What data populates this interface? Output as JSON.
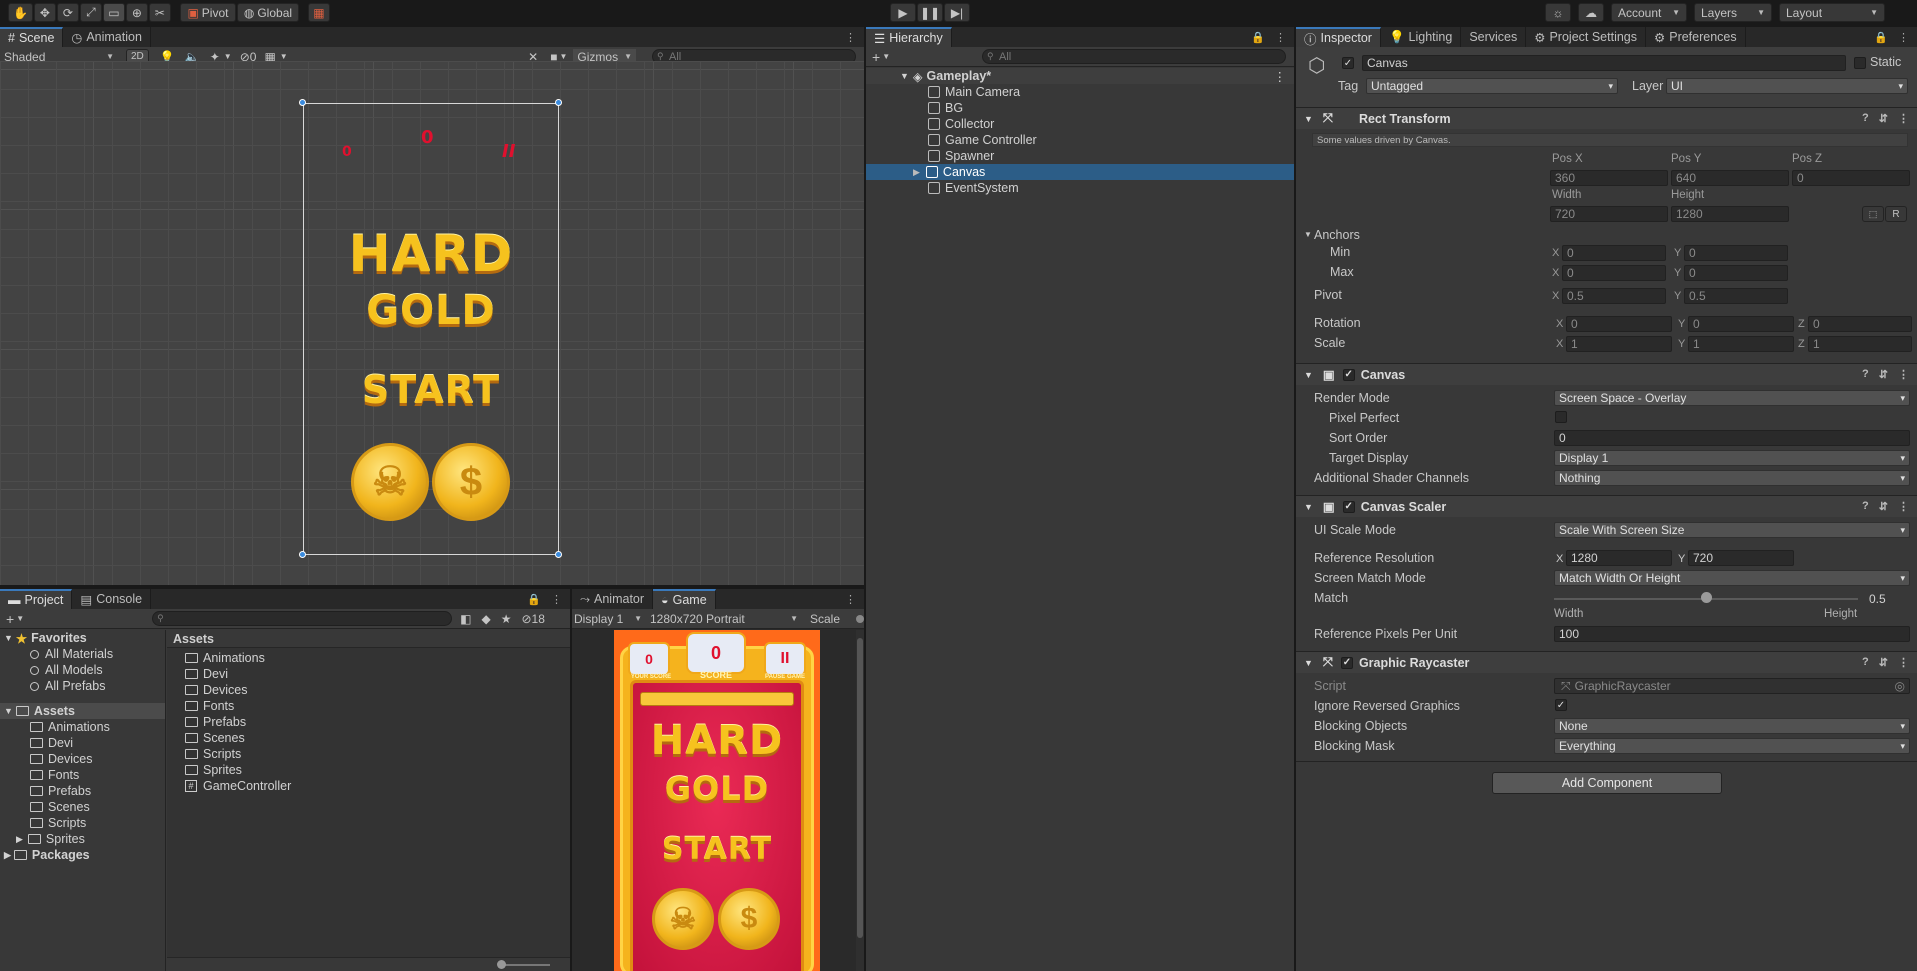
{
  "toolbar": {
    "pivot": "Pivot",
    "global": "Global",
    "account": "Account",
    "layers": "Layers",
    "layout": "Layout"
  },
  "scene": {
    "tabs": [
      "Scene",
      "Animation"
    ],
    "shade": "Shaded",
    "mode2d": "2D",
    "hidden_count": "0",
    "gizmos": "Gizmos",
    "search_placeholder": "All",
    "game": {
      "icon1": "0",
      "icon2": "0",
      "icon3": "II",
      "title1": "HARD",
      "title2": "GOLD",
      "start": "START"
    }
  },
  "hierarchy": {
    "tab": "Hierarchy",
    "search_placeholder": "All",
    "root": "Gameplay*",
    "items": [
      "Main Camera",
      "BG",
      "Collector",
      "Game Controller",
      "Spawner",
      "Canvas",
      "EventSystem"
    ]
  },
  "project": {
    "tabs": [
      "Project",
      "Console"
    ],
    "count": "18",
    "favorites": {
      "label": "Favorites",
      "items": [
        "All Materials",
        "All Models",
        "All Prefabs"
      ]
    },
    "assets": {
      "label": "Assets",
      "items": [
        "Animations",
        "Devi",
        "Devices",
        "Fonts",
        "Prefabs",
        "Scenes",
        "Scripts",
        "Sprites"
      ]
    },
    "packages": "Packages",
    "grid_header": "Assets",
    "grid_items": [
      "Animations",
      "Devi",
      "Devices",
      "Fonts",
      "Prefabs",
      "Scenes",
      "Scripts",
      "Sprites",
      "GameController"
    ]
  },
  "game": {
    "tabs": [
      "Animator",
      "Game"
    ],
    "display": "Display 1",
    "resolution": "1280x720 Portrait",
    "scale_label": "Scale",
    "view": {
      "badge1": "0",
      "badge2": "0",
      "badge3": "II",
      "left_label": "YOUR SCORE",
      "mid_label": "SCORE",
      "right_label": "PAUSE GAME",
      "title1": "HARD",
      "title2": "GOLD",
      "start": "START"
    }
  },
  "inspector": {
    "tabs": [
      "Inspector",
      "Lighting",
      "Services",
      "Project Settings",
      "Preferences"
    ],
    "object_name": "Canvas",
    "static": "Static",
    "tag_label": "Tag",
    "tag": "Untagged",
    "layer_label": "Layer",
    "layer": "UI",
    "rect": {
      "title": "Rect Transform",
      "note": "Some values driven by Canvas.",
      "posx_label": "Pos X",
      "posy_label": "Pos Y",
      "posz_label": "Pos Z",
      "posx": "360",
      "posy": "640",
      "posz": "0",
      "width_label": "Width",
      "height_label": "Height",
      "width": "720",
      "height": "1280",
      "anchors": "Anchors",
      "min": "Min",
      "max": "Max",
      "min_x": "0",
      "min_y": "0",
      "max_x": "0",
      "max_y": "0",
      "pivot": "Pivot",
      "pivot_x": "0.5",
      "pivot_y": "0.5",
      "rotation": "Rotation",
      "rot_x": "0",
      "rot_y": "0",
      "rot_z": "0",
      "scale": "Scale",
      "scale_x": "1",
      "scale_y": "1",
      "scale_z": "1",
      "r_button": "R"
    },
    "canvas": {
      "title": "Canvas",
      "render_mode_label": "Render Mode",
      "render_mode": "Screen Space - Overlay",
      "pixel_perfect_label": "Pixel Perfect",
      "sort_order_label": "Sort Order",
      "sort_order": "0",
      "target_display_label": "Target Display",
      "target_display": "Display 1",
      "shader_channels_label": "Additional Shader Channels",
      "shader_channels": "Nothing"
    },
    "scaler": {
      "title": "Canvas Scaler",
      "ui_scale_label": "UI Scale Mode",
      "ui_scale": "Scale With Screen Size",
      "ref_res_label": "Reference Resolution",
      "ref_x": "1280",
      "ref_y": "720",
      "match_mode_label": "Screen Match Mode",
      "match_mode": "Match Width Or Height",
      "match_label": "Match",
      "match": "0.5",
      "match_left": "Width",
      "match_right": "Height",
      "ppu_label": "Reference Pixels Per Unit",
      "ppu": "100"
    },
    "raycaster": {
      "title": "Graphic Raycaster",
      "script_label": "Script",
      "script": "GraphicRaycaster",
      "ignore_label": "Ignore Reversed Graphics",
      "blocking_objects_label": "Blocking Objects",
      "blocking_objects": "None",
      "blocking_mask_label": "Blocking Mask",
      "blocking_mask": "Everything"
    },
    "add_component": "Add Component"
  },
  "axis": {
    "x": "X",
    "y": "Y",
    "z": "Z"
  }
}
